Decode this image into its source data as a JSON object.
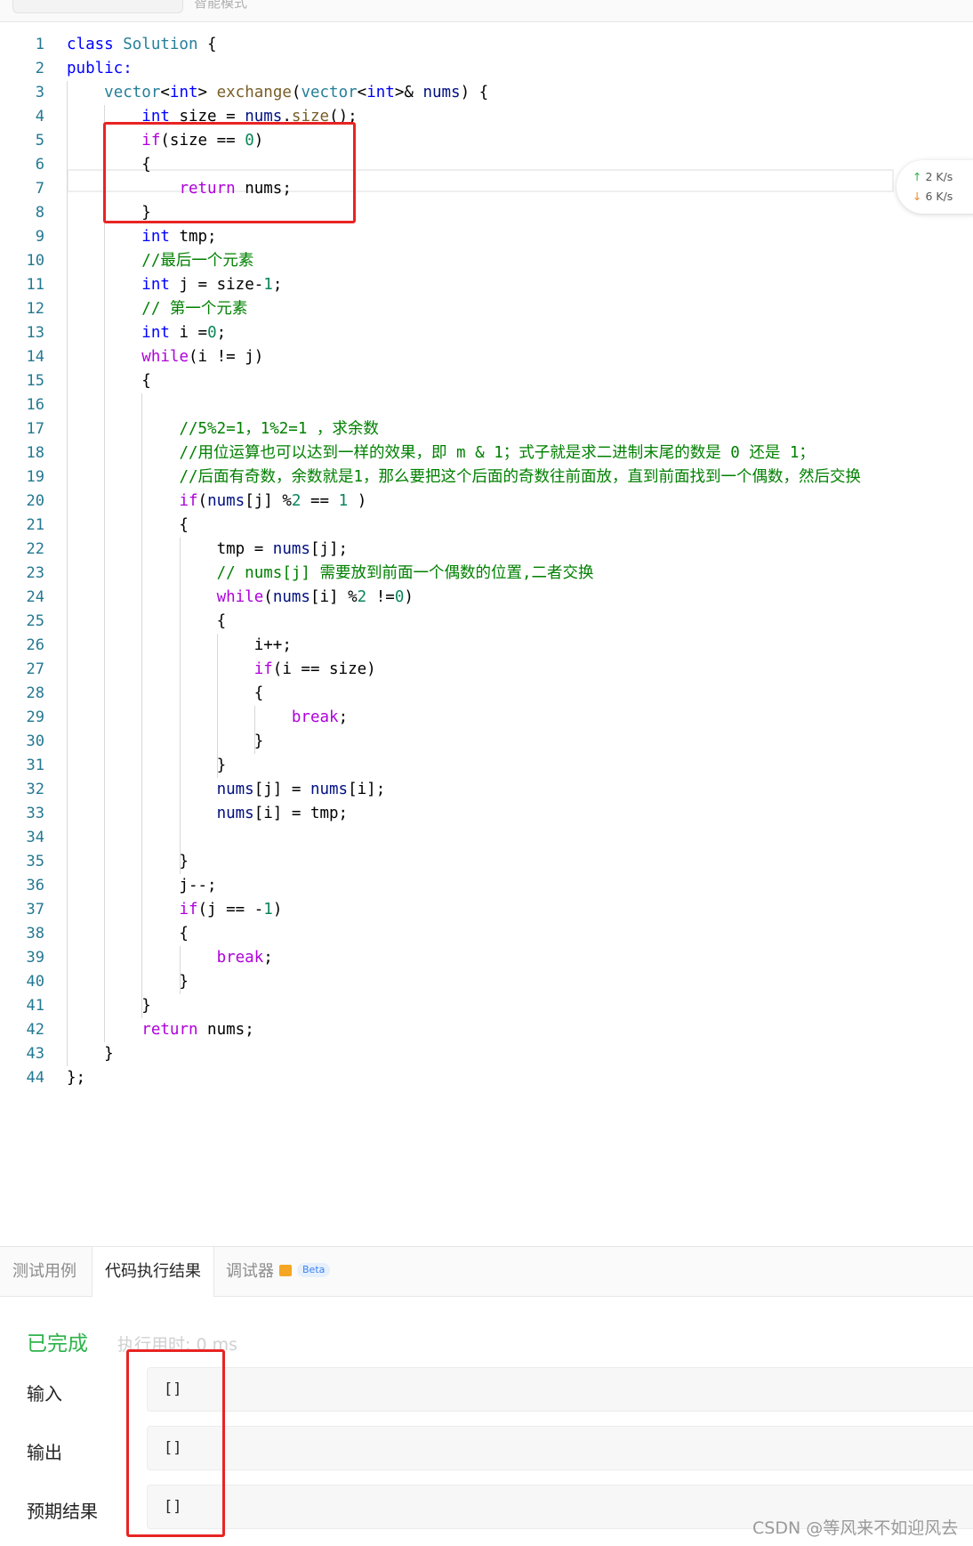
{
  "top_tabs": [
    "",
    "智能模式"
  ],
  "editor": {
    "lines": [
      {
        "num": "1",
        "tokens": [
          {
            "t": "class ",
            "c": "kw"
          },
          {
            "t": "Solution",
            "c": "ty"
          },
          {
            "t": " {",
            "c": ""
          }
        ]
      },
      {
        "num": "2",
        "tokens": [
          {
            "t": "public:",
            "c": "kw"
          }
        ]
      },
      {
        "num": "3",
        "tokens": [
          {
            "t": "    ",
            "c": ""
          },
          {
            "t": "vector",
            "c": "ty"
          },
          {
            "t": "<",
            "c": ""
          },
          {
            "t": "int",
            "c": "kw"
          },
          {
            "t": "> ",
            "c": ""
          },
          {
            "t": "exchange",
            "c": "fn"
          },
          {
            "t": "(",
            "c": ""
          },
          {
            "t": "vector",
            "c": "ty"
          },
          {
            "t": "<",
            "c": ""
          },
          {
            "t": "int",
            "c": "kw"
          },
          {
            "t": ">& ",
            "c": ""
          },
          {
            "t": "nums",
            "c": "vr"
          },
          {
            "t": ") {",
            "c": ""
          }
        ]
      },
      {
        "num": "4",
        "tokens": [
          {
            "t": "        ",
            "c": ""
          },
          {
            "t": "int",
            "c": "kw"
          },
          {
            "t": " size = ",
            "c": ""
          },
          {
            "t": "nums",
            "c": "vr"
          },
          {
            "t": ".",
            "c": ""
          },
          {
            "t": "size",
            "c": "fn"
          },
          {
            "t": "();",
            "c": ""
          }
        ]
      },
      {
        "num": "5",
        "tokens": [
          {
            "t": "        ",
            "c": ""
          },
          {
            "t": "if",
            "c": "kw2"
          },
          {
            "t": "(size == ",
            "c": ""
          },
          {
            "t": "0",
            "c": "nm"
          },
          {
            "t": ")",
            "c": ""
          }
        ]
      },
      {
        "num": "6",
        "tokens": [
          {
            "t": "        {",
            "c": ""
          }
        ]
      },
      {
        "num": "7",
        "tokens": [
          {
            "t": "            ",
            "c": ""
          },
          {
            "t": "return",
            "c": "kw2"
          },
          {
            "t": " nums;",
            "c": ""
          }
        ]
      },
      {
        "num": "8",
        "tokens": [
          {
            "t": "        }",
            "c": ""
          }
        ]
      },
      {
        "num": "9",
        "tokens": [
          {
            "t": "        ",
            "c": ""
          },
          {
            "t": "int",
            "c": "kw"
          },
          {
            "t": " tmp;",
            "c": ""
          }
        ]
      },
      {
        "num": "10",
        "tokens": [
          {
            "t": "        ",
            "c": ""
          },
          {
            "t": "//最后一个元素",
            "c": "cm"
          }
        ]
      },
      {
        "num": "11",
        "tokens": [
          {
            "t": "        ",
            "c": ""
          },
          {
            "t": "int",
            "c": "kw"
          },
          {
            "t": " j = size-",
            "c": ""
          },
          {
            "t": "1",
            "c": "nm"
          },
          {
            "t": ";",
            "c": ""
          }
        ]
      },
      {
        "num": "12",
        "tokens": [
          {
            "t": "        ",
            "c": ""
          },
          {
            "t": "// 第一个元素",
            "c": "cm"
          }
        ]
      },
      {
        "num": "13",
        "tokens": [
          {
            "t": "        ",
            "c": ""
          },
          {
            "t": "int",
            "c": "kw"
          },
          {
            "t": " i =",
            "c": ""
          },
          {
            "t": "0",
            "c": "nm"
          },
          {
            "t": ";",
            "c": ""
          }
        ]
      },
      {
        "num": "14",
        "tokens": [
          {
            "t": "        ",
            "c": ""
          },
          {
            "t": "while",
            "c": "kw2"
          },
          {
            "t": "(i != j)",
            "c": ""
          }
        ]
      },
      {
        "num": "15",
        "tokens": [
          {
            "t": "        {",
            "c": ""
          }
        ]
      },
      {
        "num": "16",
        "tokens": [
          {
            "t": "",
            "c": ""
          }
        ]
      },
      {
        "num": "17",
        "tokens": [
          {
            "t": "            ",
            "c": ""
          },
          {
            "t": "//5%2=1，1%2=1 ，求余数",
            "c": "cm"
          }
        ]
      },
      {
        "num": "18",
        "tokens": [
          {
            "t": "            ",
            "c": ""
          },
          {
            "t": "//用位运算也可以达到一样的效果，即 m & 1；式子就是求二进制末尾的数是 0 还是 1；",
            "c": "cm"
          }
        ]
      },
      {
        "num": "19",
        "tokens": [
          {
            "t": "            ",
            "c": ""
          },
          {
            "t": "//后面有奇数，余数就是1，那么要把这个后面的奇数往前面放，直到前面找到一个偶数，然后交换",
            "c": "cm"
          }
        ]
      },
      {
        "num": "20",
        "tokens": [
          {
            "t": "            ",
            "c": ""
          },
          {
            "t": "if",
            "c": "kw2"
          },
          {
            "t": "(",
            "c": ""
          },
          {
            "t": "nums",
            "c": "vr"
          },
          {
            "t": "[j] %",
            "c": ""
          },
          {
            "t": "2",
            "c": "nm"
          },
          {
            "t": " == ",
            "c": ""
          },
          {
            "t": "1",
            "c": "nm"
          },
          {
            "t": " )",
            "c": ""
          }
        ]
      },
      {
        "num": "21",
        "tokens": [
          {
            "t": "            {",
            "c": ""
          }
        ]
      },
      {
        "num": "22",
        "tokens": [
          {
            "t": "                tmp = ",
            "c": ""
          },
          {
            "t": "nums",
            "c": "vr"
          },
          {
            "t": "[j];",
            "c": ""
          }
        ]
      },
      {
        "num": "23",
        "tokens": [
          {
            "t": "                ",
            "c": ""
          },
          {
            "t": "// nums[j] 需要放到前面一个偶数的位置,二者交换",
            "c": "cm"
          }
        ]
      },
      {
        "num": "24",
        "tokens": [
          {
            "t": "                ",
            "c": ""
          },
          {
            "t": "while",
            "c": "kw2"
          },
          {
            "t": "(",
            "c": ""
          },
          {
            "t": "nums",
            "c": "vr"
          },
          {
            "t": "[i] %",
            "c": ""
          },
          {
            "t": "2",
            "c": "nm"
          },
          {
            "t": " !=",
            "c": ""
          },
          {
            "t": "0",
            "c": "nm"
          },
          {
            "t": ")",
            "c": ""
          }
        ]
      },
      {
        "num": "25",
        "tokens": [
          {
            "t": "                {",
            "c": ""
          }
        ]
      },
      {
        "num": "26",
        "tokens": [
          {
            "t": "                    i++;",
            "c": ""
          }
        ]
      },
      {
        "num": "27",
        "tokens": [
          {
            "t": "                    ",
            "c": ""
          },
          {
            "t": "if",
            "c": "kw2"
          },
          {
            "t": "(i == size)",
            "c": ""
          }
        ]
      },
      {
        "num": "28",
        "tokens": [
          {
            "t": "                    {",
            "c": ""
          }
        ]
      },
      {
        "num": "29",
        "tokens": [
          {
            "t": "                        ",
            "c": ""
          },
          {
            "t": "break",
            "c": "kw2"
          },
          {
            "t": ";",
            "c": ""
          }
        ]
      },
      {
        "num": "30",
        "tokens": [
          {
            "t": "                    }",
            "c": ""
          }
        ]
      },
      {
        "num": "31",
        "tokens": [
          {
            "t": "                }",
            "c": ""
          }
        ]
      },
      {
        "num": "32",
        "tokens": [
          {
            "t": "                ",
            "c": ""
          },
          {
            "t": "nums",
            "c": "vr"
          },
          {
            "t": "[j] = ",
            "c": ""
          },
          {
            "t": "nums",
            "c": "vr"
          },
          {
            "t": "[i];",
            "c": ""
          }
        ]
      },
      {
        "num": "33",
        "tokens": [
          {
            "t": "                ",
            "c": ""
          },
          {
            "t": "nums",
            "c": "vr"
          },
          {
            "t": "[i] = tmp;",
            "c": ""
          }
        ]
      },
      {
        "num": "34",
        "tokens": [
          {
            "t": "",
            "c": ""
          }
        ]
      },
      {
        "num": "35",
        "tokens": [
          {
            "t": "            }",
            "c": ""
          }
        ]
      },
      {
        "num": "36",
        "tokens": [
          {
            "t": "            j--;",
            "c": ""
          }
        ]
      },
      {
        "num": "37",
        "tokens": [
          {
            "t": "            ",
            "c": ""
          },
          {
            "t": "if",
            "c": "kw2"
          },
          {
            "t": "(j == -",
            "c": ""
          },
          {
            "t": "1",
            "c": "nm"
          },
          {
            "t": ")",
            "c": ""
          }
        ]
      },
      {
        "num": "38",
        "tokens": [
          {
            "t": "            {",
            "c": ""
          }
        ]
      },
      {
        "num": "39",
        "tokens": [
          {
            "t": "                ",
            "c": ""
          },
          {
            "t": "break",
            "c": "kw2"
          },
          {
            "t": ";",
            "c": ""
          }
        ]
      },
      {
        "num": "40",
        "tokens": [
          {
            "t": "            }",
            "c": ""
          }
        ]
      },
      {
        "num": "41",
        "tokens": [
          {
            "t": "        }",
            "c": ""
          }
        ]
      },
      {
        "num": "42",
        "tokens": [
          {
            "t": "        ",
            "c": ""
          },
          {
            "t": "return",
            "c": "kw2"
          },
          {
            "t": " nums;",
            "c": ""
          }
        ]
      },
      {
        "num": "43",
        "tokens": [
          {
            "t": "    }",
            "c": ""
          }
        ]
      },
      {
        "num": "44",
        "tokens": [
          {
            "t": "};",
            "c": ""
          }
        ]
      }
    ]
  },
  "network_speed": {
    "up": "2  K/s",
    "down": "6  K/s",
    "up_color": "#2db34a",
    "down_color": "#f08a24"
  },
  "panel": {
    "tabs": [
      "测试用例",
      "代码执行结果",
      "调试器"
    ],
    "active_tab": "代码执行结果",
    "beta_label": "Beta",
    "status": "已完成",
    "exec_time": "执行用时: 0 ms",
    "input_label": "输入",
    "input_value": "[]",
    "output_label": "输出",
    "output_value": "[]",
    "expected_label": "预期结果",
    "expected_value": "[]"
  },
  "watermark": "CSDN @等风来不如迎风去",
  "colors": {
    "highlight_box": "#e82424",
    "success": "#2db34a"
  }
}
